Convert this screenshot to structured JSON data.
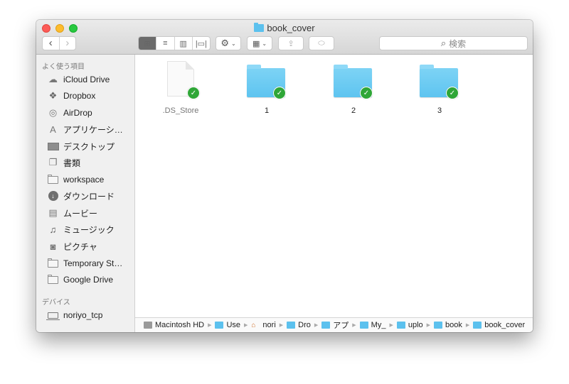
{
  "window": {
    "title": "book_cover"
  },
  "toolbar": {
    "back": "‹",
    "forward": "›",
    "view_modes": [
      {
        "name": "icon-view",
        "glyph": "⊞",
        "active": true
      },
      {
        "name": "list-view",
        "glyph": "≡",
        "active": false
      },
      {
        "name": "column-view",
        "glyph": "▥",
        "active": false
      },
      {
        "name": "cover-flow-view",
        "glyph": "|▭|",
        "active": false
      }
    ],
    "action_glyph": "⚙",
    "arrange_glyph": "▦",
    "chevron": "⌄",
    "share_glyph": "⇪",
    "tag_glyph": "⬭",
    "search_icon": "⌕",
    "search_placeholder": "検索"
  },
  "sidebar": {
    "favorites_header": "よく使う項目",
    "favorites": [
      {
        "label": "iCloud Drive",
        "icon": "cloud-icon"
      },
      {
        "label": "Dropbox",
        "icon": "dropbox-icon"
      },
      {
        "label": "AirDrop",
        "icon": "airdrop-icon"
      },
      {
        "label": "アプリケーシ…",
        "icon": "applications-icon"
      },
      {
        "label": "デスクトップ",
        "icon": "desktop-icon"
      },
      {
        "label": "書類",
        "icon": "documents-icon"
      },
      {
        "label": "workspace",
        "icon": "folder-icon"
      },
      {
        "label": "ダウンロード",
        "icon": "downloads-icon"
      },
      {
        "label": "ムービー",
        "icon": "movies-icon"
      },
      {
        "label": "ミュージック",
        "icon": "music-icon"
      },
      {
        "label": "ピクチャ",
        "icon": "pictures-icon"
      },
      {
        "label": "Temporary St…",
        "icon": "folder-icon"
      },
      {
        "label": "Google Drive",
        "icon": "folder-icon"
      }
    ],
    "devices_header": "デバイス",
    "devices": [
      {
        "label": "noriyo_tcp",
        "icon": "laptop-icon"
      }
    ]
  },
  "files": [
    {
      "name": ".DS_Store",
      "type": "document",
      "synced": true
    },
    {
      "name": "1",
      "type": "folder",
      "synced": true
    },
    {
      "name": "2",
      "type": "folder",
      "synced": true
    },
    {
      "name": "3",
      "type": "folder",
      "synced": true
    }
  ],
  "path_bar": [
    {
      "label": "Macintosh HD",
      "icon": "hard-drive-icon"
    },
    {
      "label": "Use",
      "icon": "users-folder-icon"
    },
    {
      "label": "nori",
      "icon": "home-icon"
    },
    {
      "label": "Dro",
      "icon": "dropbox-folder-icon"
    },
    {
      "label": "アプ",
      "icon": "folder-icon"
    },
    {
      "label": "My_",
      "icon": "folder-icon"
    },
    {
      "label": "uplo",
      "icon": "folder-icon"
    },
    {
      "label": "book",
      "icon": "folder-icon"
    },
    {
      "label": "book_cover",
      "icon": "folder-icon"
    }
  ],
  "colors": {
    "folder_blue": "#5ec4f0",
    "sync_green": "#2fa637",
    "close": "#fc5b57",
    "minimize": "#fdbc2e",
    "maximize": "#28c83f"
  }
}
